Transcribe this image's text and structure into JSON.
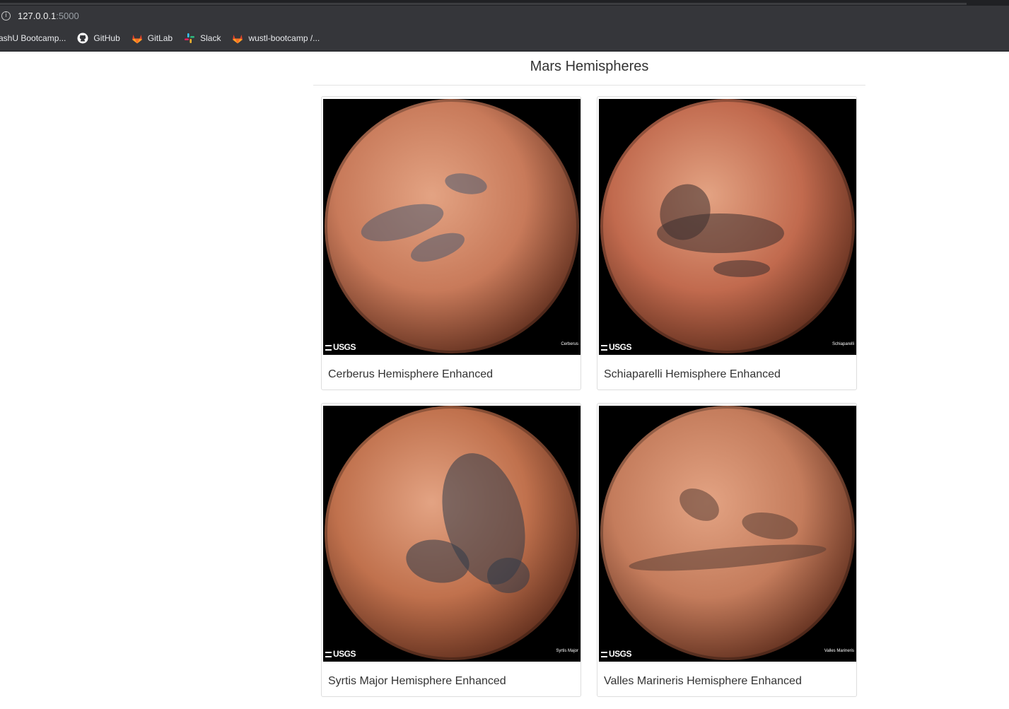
{
  "browser": {
    "url_host": "127.0.0.1",
    "url_port": ":5000",
    "bookmarks": [
      {
        "label": "ashU Bootcamp...",
        "icon": "none"
      },
      {
        "label": "GitHub",
        "icon": "github-icon"
      },
      {
        "label": "GitLab",
        "icon": "gitlab-icon"
      },
      {
        "label": "Slack",
        "icon": "slack-icon"
      },
      {
        "label": "wustl-bootcamp /...",
        "icon": "gitlab-icon"
      }
    ]
  },
  "page": {
    "title": "Mars Hemispheres",
    "hemispheres": [
      {
        "title": "Cerberus Hemisphere Enhanced",
        "image_caption": "Cerberus",
        "base_color": "#c87a5a",
        "dark_color": "#4d5a6e"
      },
      {
        "title": "Schiaparelli Hemisphere Enhanced",
        "image_caption": "Schiaparelli",
        "base_color": "#c16a4e",
        "dark_color": "#3d3030"
      },
      {
        "title": "Syrtis Major Hemisphere Enhanced",
        "image_caption": "Syrtis Major",
        "base_color": "#c0714d",
        "dark_color": "#2f3a48"
      },
      {
        "title": "Valles Marineris Hemisphere Enhanced",
        "image_caption": "Valles Marineris",
        "base_color": "#c47c5c",
        "dark_color": "#5a3e34"
      }
    ],
    "image_brand": "USGS"
  }
}
